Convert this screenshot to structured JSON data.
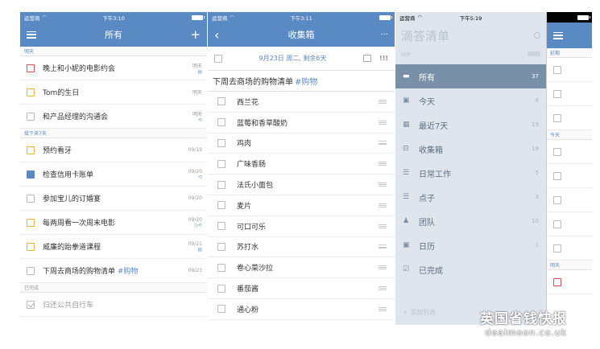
{
  "phone1": {
    "status": {
      "carrier": "运营商",
      "time": "下午3:10"
    },
    "nav": {
      "title": "所有",
      "add": "+"
    },
    "sections": {
      "tomorrow": "明天",
      "next7": "接下来7天",
      "done": "已完成"
    },
    "tasks_tomorrow": [
      {
        "title": "晚上和小妮的电影约会",
        "meta": "明天",
        "color": "red",
        "icon": "calendar-icon"
      },
      {
        "title": "Tom的生日",
        "meta": "明天",
        "color": "yellow"
      },
      {
        "title": "和产品经理的沟通会",
        "meta": "明天",
        "color": "gray",
        "icon": "repeat-icon"
      }
    ],
    "tasks_next7": [
      {
        "title": "预约看牙",
        "meta": "09/19",
        "color": "yellow"
      },
      {
        "title": "检查信用卡账单",
        "meta": "09/20",
        "color": "blue",
        "icon": "repeat-icon"
      },
      {
        "title": "参加宝儿的订婚宴",
        "meta": "09/20",
        "color": "gray"
      },
      {
        "title": "每两周看一次周末电影",
        "meta": "09/20",
        "color": "yellow",
        "icon": "alarm-repeat-icon"
      },
      {
        "title": "威廉的跆拳道课程",
        "meta": "09/21",
        "color": "yellow",
        "icon": "calendar-icon"
      },
      {
        "title": "下周去商场的购物清单 #购物",
        "meta": "09/23",
        "color": "gray"
      }
    ],
    "tasks_done": [
      {
        "title": "归还公共自行车"
      }
    ]
  },
  "phone2": {
    "status": {
      "carrier": "运营商",
      "time": "下午3:11"
    },
    "nav": {
      "title": "收集箱",
      "back": "‹",
      "more": "···"
    },
    "date": "9月23日 周二, 剩余6天",
    "priority": "!!!",
    "list_title": "下周去商场的购物清单",
    "list_tag": "#购物",
    "items": [
      "西兰花",
      "蓝莓和香草酸奶",
      "鸡肉",
      "广味香肠",
      "法氏小面包",
      "麦片",
      "可口可乐",
      "苏打水",
      "卷心菜沙拉",
      "番茄酱",
      "通心粉"
    ]
  },
  "phone3": {
    "status": {
      "carrier": "运营商",
      "time": "下午5:19"
    },
    "brand": "滴答清单",
    "sub": "同步",
    "menu": [
      {
        "label": "所有",
        "count": "37",
        "icon": "inbox-icon",
        "active": true
      },
      {
        "label": "今天",
        "count": "8",
        "icon": "calendar-icon"
      },
      {
        "label": "最近7天",
        "count": "19",
        "icon": "calendar-week-icon"
      },
      {
        "label": "收集箱",
        "count": "18",
        "icon": "inbox-tray-icon"
      },
      {
        "label": "日常工作",
        "count": "5",
        "icon": "list-icon"
      },
      {
        "label": "点子",
        "count": "3",
        "icon": "list-icon"
      },
      {
        "label": "团队",
        "count": "10",
        "icon": "team-icon"
      },
      {
        "label": "日历",
        "count": "1",
        "icon": "calendar-icon"
      },
      {
        "label": "已完成",
        "count": "",
        "icon": "checkbox-icon"
      }
    ],
    "footer": "+ 添加列表",
    "peek_sections": {
      "overdue": "延期",
      "today": "今天",
      "tomorrow": "明天"
    }
  },
  "watermark": {
    "line1": "英国省钱快报",
    "line2": "dealmoon.co.uk"
  }
}
